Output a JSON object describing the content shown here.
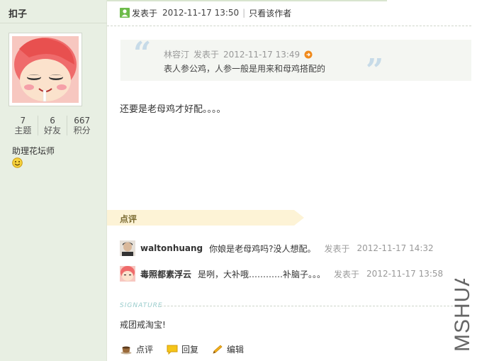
{
  "user": {
    "name": "扣子",
    "stats": [
      {
        "value": "7",
        "label": "主题"
      },
      {
        "value": "6",
        "label": "好友"
      },
      {
        "value": "667",
        "label": "积分"
      }
    ],
    "rank": "助理花坛师",
    "icons": {
      "avatar": "pink-hooded-cartoon-avatar",
      "rank": "smiley-face-icon"
    }
  },
  "post": {
    "posted_label": "发表于",
    "date": "2012-11-17 13:50",
    "author_only": "只看该作者",
    "quote": {
      "author": "林容汀",
      "posted_label": "发表于",
      "date": "2012-11-17 13:49",
      "text": "表人参公鸡，人参一般是用来和母鸡搭配的"
    },
    "body": "还要是老母鸡才好配。。。。"
  },
  "comments": {
    "title": "点评",
    "items": [
      {
        "user": "waltonhuang",
        "text": "你娘是老母鸡吗?没人想配。",
        "posted_label": "发表于",
        "date": "2012-11-17 14:32"
      },
      {
        "user": "毒照都素浮云",
        "text": "是咧，大补哦…………补脑子。。。",
        "posted_label": "发表于",
        "date": "2012-11-17 13:58"
      }
    ]
  },
  "signature": {
    "label": "SIGNATURE",
    "text": "戒团戒淘宝!"
  },
  "actions": {
    "comment": "点评",
    "reply": "回复",
    "edit": "编辑"
  },
  "watermark": "MSHUA",
  "colors": {
    "sidebar_bg": "#e8efe3",
    "quote_mark": "#c7dbe8",
    "banner": "#fdf3d6",
    "muted": "#999999"
  }
}
